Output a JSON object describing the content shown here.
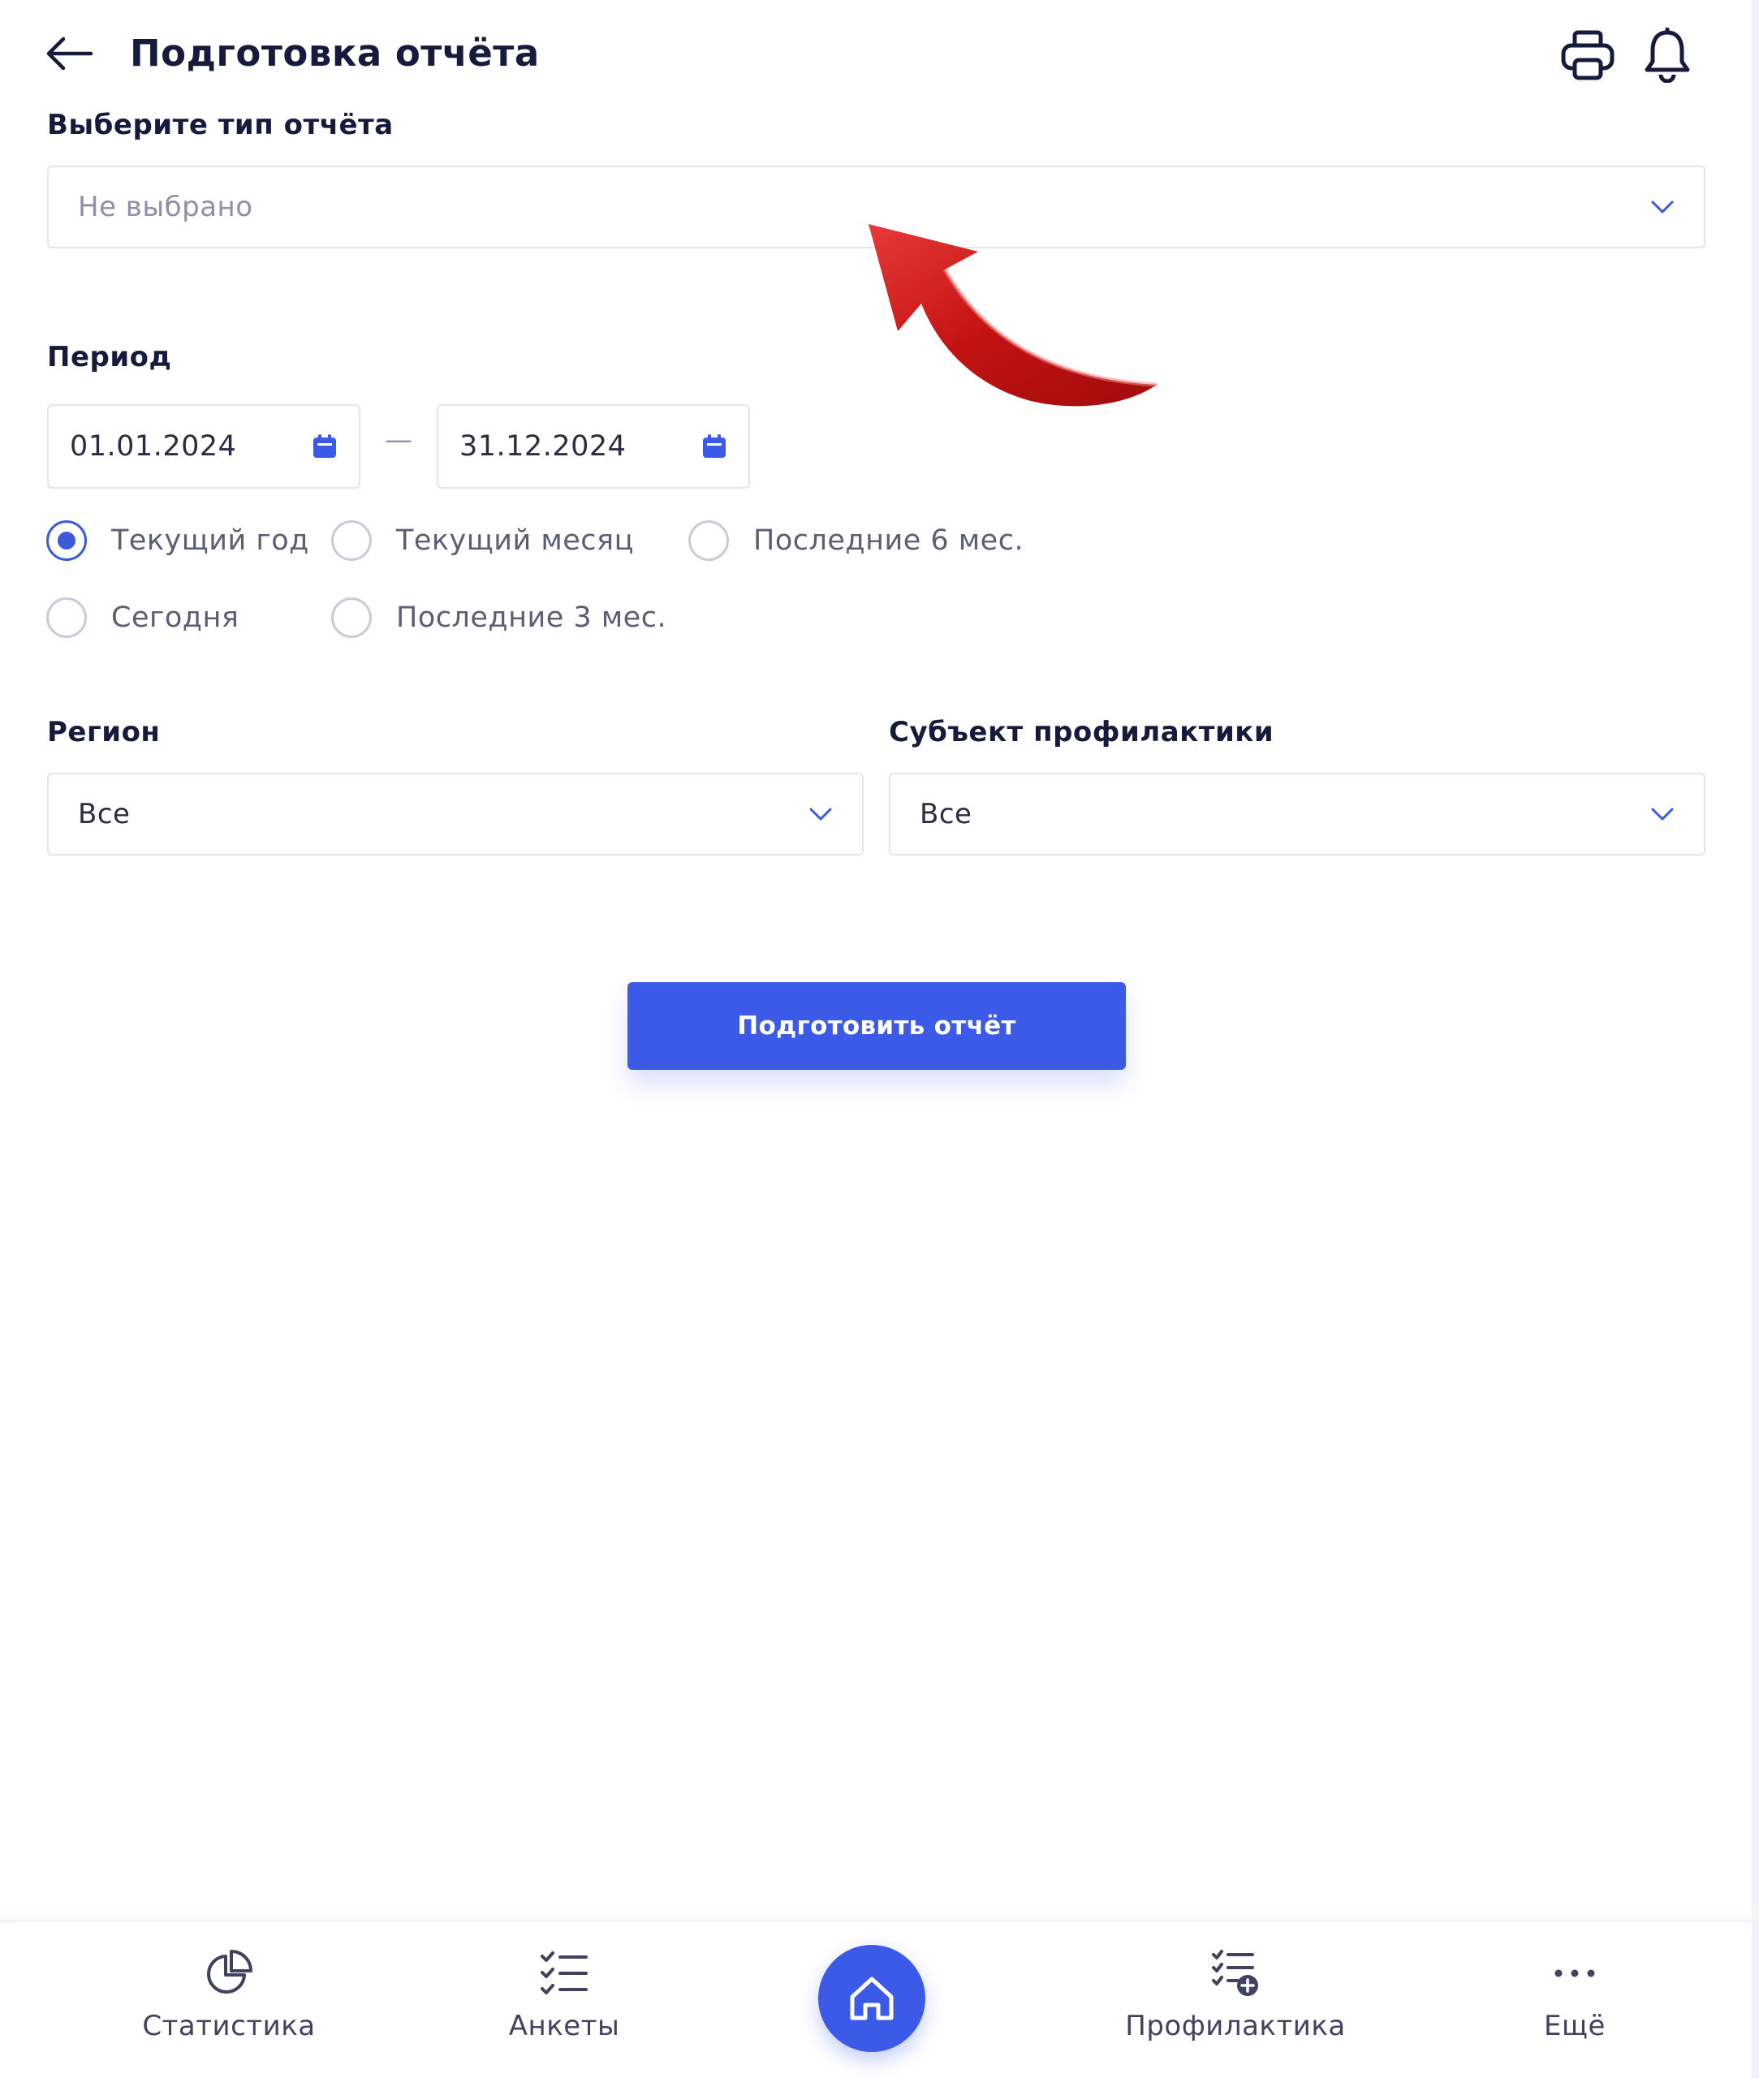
{
  "header": {
    "title": "Подготовка отчёта",
    "icons": [
      "back-arrow-icon",
      "printer-icon",
      "bell-icon"
    ]
  },
  "report_type": {
    "label": "Выберите тип отчёта",
    "placeholder": "Не выбрано"
  },
  "period": {
    "label": "Период",
    "date_from": "01.01.2024",
    "date_to": "31.12.2024",
    "separator": "—",
    "options": [
      {
        "label": "Текущий год",
        "checked": true
      },
      {
        "label": "Текущий месяц",
        "checked": false
      },
      {
        "label": "Последние 6 мес.",
        "checked": false
      },
      {
        "label": "Сегодня",
        "checked": false
      },
      {
        "label": "Последние 3 мес.",
        "checked": false
      }
    ]
  },
  "region": {
    "label": "Регион",
    "value": "Все"
  },
  "subject": {
    "label": "Субъект профилактики",
    "value": "Все"
  },
  "submit_button": "Подготовить отчёт",
  "bottom_nav": {
    "items": [
      {
        "label": "Статистика",
        "icon": "pie-chart-icon"
      },
      {
        "label": "Анкеты",
        "icon": "checklist-icon"
      },
      {
        "label": "",
        "icon": "home-icon"
      },
      {
        "label": "Профилактика",
        "icon": "checklist-add-icon"
      },
      {
        "label": "Ещё",
        "icon": "more-dots-icon"
      }
    ]
  },
  "colors": {
    "accent": "#3b5ae8",
    "annotation_arrow": "#d81e1e"
  }
}
